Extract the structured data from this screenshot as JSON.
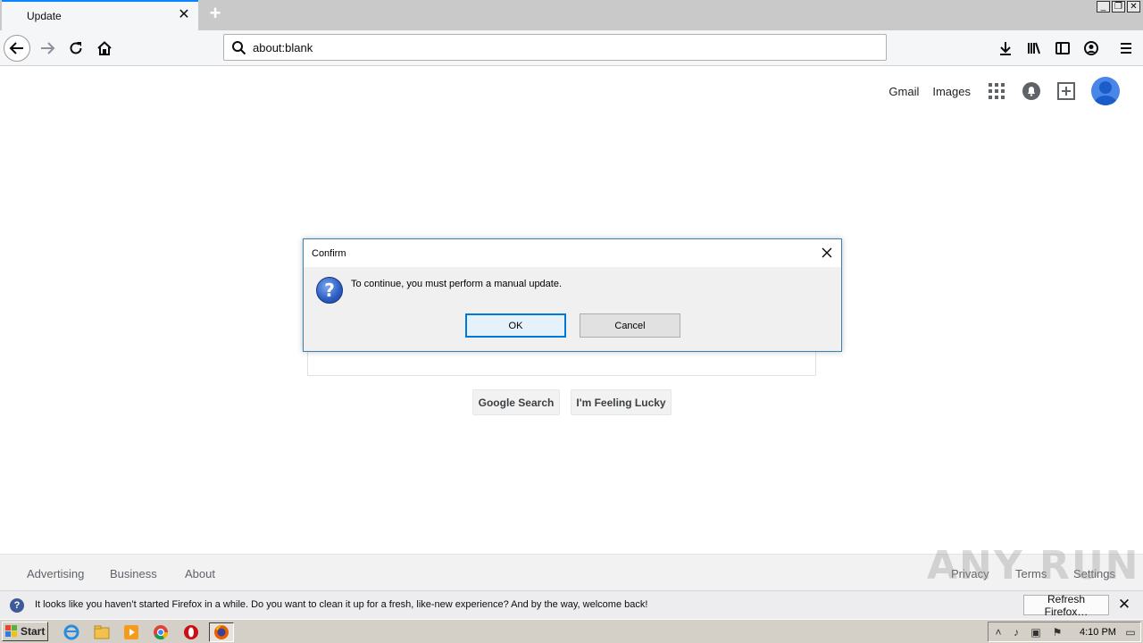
{
  "browser": {
    "tab_title": "Update",
    "url": "about:blank"
  },
  "google": {
    "header_links": [
      "Gmail",
      "Images"
    ],
    "buttons": {
      "search": "Google Search",
      "lucky": "I'm Feeling Lucky"
    },
    "footer_left": [
      "Advertising",
      "Business",
      "About"
    ],
    "footer_right": [
      "Privacy",
      "Terms",
      "Settings"
    ]
  },
  "watermark": "ANY RUN",
  "dialog": {
    "title": "Confirm",
    "message": "To continue, you must perform a manual update.",
    "ok_label": "OK",
    "cancel_label": "Cancel"
  },
  "notification": {
    "text": "It looks like you haven’t started Firefox in a while. Do you want to clean it up for a fresh, like-new experience? And by the way, welcome back!",
    "button_label": "Refresh Firefox…"
  },
  "taskbar": {
    "start_label": "Start",
    "clock": "4:10 PM"
  },
  "colors": {
    "accent": "#0a84ff",
    "dialog_border": "#3c7fb1",
    "ok_border": "#0078d7"
  }
}
